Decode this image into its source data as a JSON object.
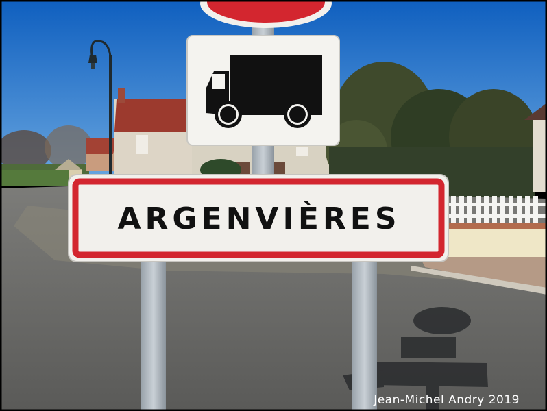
{
  "sign": {
    "town_name": "ARGENVIÈRES"
  },
  "photo": {
    "credit": "Jean-Michel Andry 2019"
  },
  "colors": {
    "sky": "#1f72c9",
    "sign_red": "#d3262f",
    "sign_white": "#f2f0ec",
    "asphalt": "#686866"
  },
  "icons": [
    "truck-icon",
    "no-entry-sign",
    "street-lamp"
  ]
}
